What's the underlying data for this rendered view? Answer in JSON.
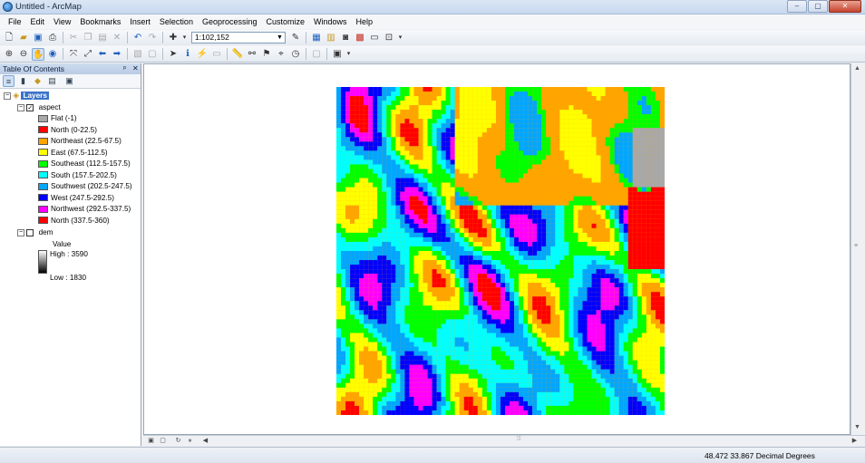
{
  "window": {
    "title": "Untitled - ArcMap",
    "ghost_title": "",
    "min": "–",
    "max": "▢",
    "close": "✕"
  },
  "menu": [
    "File",
    "Edit",
    "View",
    "Bookmarks",
    "Insert",
    "Selection",
    "Geoprocessing",
    "Customize",
    "Windows",
    "Help"
  ],
  "toolbar": {
    "scale": "1:102,152"
  },
  "toc": {
    "title": "Table Of Contents",
    "pin": "ᵖ",
    "close": "✕",
    "root": "Layers",
    "layers": [
      {
        "name": "aspect",
        "checked": true,
        "classes": [
          {
            "label": "Flat (-1)",
            "color": "#a8a8a8"
          },
          {
            "label": "North (0-22.5)",
            "color": "#ff0000"
          },
          {
            "label": "Northeast (22.5-67.5)",
            "color": "#ffa500"
          },
          {
            "label": "East (67.5-112.5)",
            "color": "#ffff00"
          },
          {
            "label": "Southeast (112.5-157.5)",
            "color": "#00ff00"
          },
          {
            "label": "South (157.5-202.5)",
            "color": "#00ffff"
          },
          {
            "label": "Southwest (202.5-247.5)",
            "color": "#00a6ff"
          },
          {
            "label": "West (247.5-292.5)",
            "color": "#0000ff"
          },
          {
            "label": "Northwest (292.5-337.5)",
            "color": "#ff00ff"
          },
          {
            "label": "North (337.5-360)",
            "color": "#ff0000"
          }
        ]
      },
      {
        "name": "dem",
        "checked": false,
        "value_label": "Value",
        "high": "High : 3590",
        "low": "Low : 1830"
      }
    ]
  },
  "status": {
    "coords": "48.472  33.867 Decimal Degrees"
  }
}
